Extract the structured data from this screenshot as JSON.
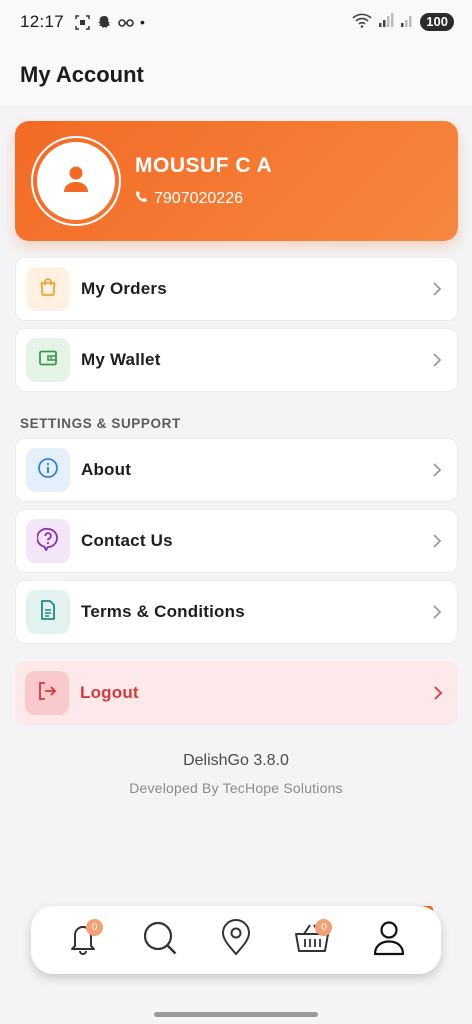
{
  "status_bar": {
    "time": "12:17",
    "dot": "•",
    "battery": "100"
  },
  "header": {
    "title": "My Account"
  },
  "profile": {
    "name": "MOUSUF C A",
    "phone": "7907020226"
  },
  "menu": {
    "orders": {
      "label": "My Orders",
      "icon": "shopping-bag-icon",
      "color": "#f2a23a",
      "bg": "#fff1e2"
    },
    "wallet": {
      "label": "My Wallet",
      "icon": "wallet-icon",
      "color": "#3b9a4a",
      "bg": "#e6f3e7"
    }
  },
  "settings": {
    "section_title": "SETTINGS & SUPPORT",
    "about": {
      "label": "About",
      "icon": "info-icon",
      "color": "#2f86d1",
      "bg": "#e4f0fb"
    },
    "contact": {
      "label": "Contact Us",
      "icon": "help-icon",
      "color": "#8a2fb0",
      "bg": "#f3e6f8"
    },
    "terms": {
      "label": "Terms & Conditions",
      "icon": "document-icon",
      "color": "#1f8a80",
      "bg": "#e1f2f0"
    }
  },
  "logout": {
    "label": "Logout",
    "icon": "logout-icon",
    "color": "#d13b3b"
  },
  "footer": {
    "version": "DelishGo 3.8.0",
    "developer": "Developed By TecHope Solutions"
  },
  "bottom_nav": {
    "items": [
      {
        "name": "notifications",
        "icon": "bell-icon",
        "badge": "0"
      },
      {
        "name": "search",
        "icon": "search-icon"
      },
      {
        "name": "location",
        "icon": "location-pin-icon"
      },
      {
        "name": "cart",
        "icon": "basket-icon",
        "badge": "0"
      },
      {
        "name": "account",
        "icon": "user-icon",
        "active": true
      }
    ]
  },
  "colors": {
    "accent": "#f26a26",
    "logout_bg": "#fde8ea"
  }
}
